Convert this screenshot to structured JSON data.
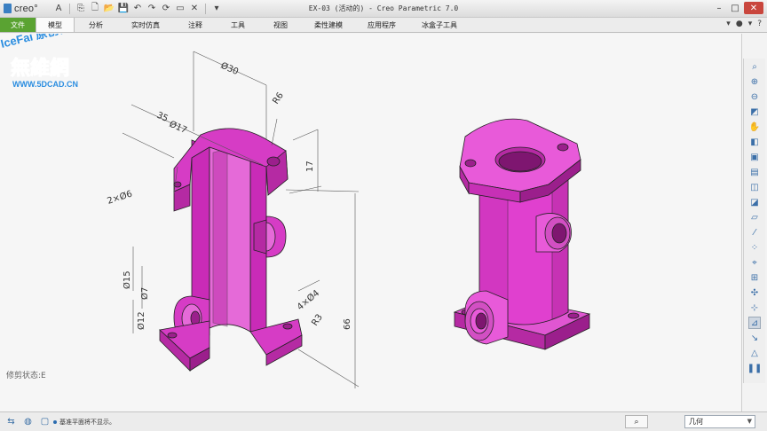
{
  "app": {
    "logo_text": "creo°"
  },
  "window": {
    "title": "EX-03 (活动的) - Creo Parametric 7.0"
  },
  "ribbon": {
    "tabs": [
      {
        "label": "文件"
      },
      {
        "label": "模型"
      },
      {
        "label": "分析"
      },
      {
        "label": "实时仿真"
      },
      {
        "label": "注释"
      },
      {
        "label": "工具"
      },
      {
        "label": "视图"
      },
      {
        "label": "柔性建模"
      },
      {
        "label": "应用程序"
      },
      {
        "label": "冰盒子工具"
      }
    ]
  },
  "graphics": {
    "clip_state": "修剪状态:E",
    "dimensions": {
      "d_top": "Ø30",
      "r_top": "R6",
      "d35": "35",
      "d17a": "Ø17",
      "d17b": "17",
      "chamfer": "2×Ø6",
      "d66": "66",
      "d15": "Ø15",
      "d7": "Ø7",
      "d12": "Ø12",
      "c4": "4×Ø4",
      "r3": "R3"
    }
  },
  "status": {
    "message": "基准平面将不显示。",
    "filter_value": "几何"
  },
  "watermark": {
    "line1": "IceFai 原创作品",
    "line2": "無維網",
    "line3": "WWW.5DCAD.CN"
  },
  "colors": {
    "model": "#e040cf",
    "dim": "#555555",
    "accent": "#5aa332"
  }
}
